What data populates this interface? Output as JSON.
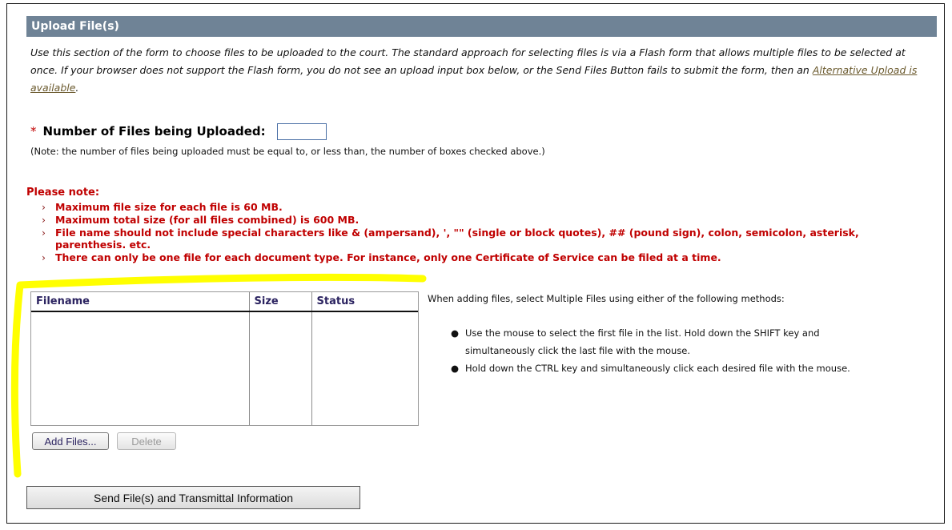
{
  "section": {
    "title": "Upload File(s)"
  },
  "intro": {
    "text_before_link": "Use this section of the form to choose files to be uploaded to the court. The standard approach for selecting files is via a Flash form that allows multiple files to be selected at once. If your browser does not support the Flash form, you do not see an upload input box below, or the Send Files Button fails to submit the form, then an ",
    "link_text": "Alternative Upload is available",
    "text_after_link": "."
  },
  "file_count": {
    "required_marker": "*",
    "label": "Number of Files being Uploaded:",
    "value": "",
    "note": "(Note: the number of files being uploaded must be equal to, or less than, the number of boxes checked above.)"
  },
  "notes": {
    "heading": "Please note:",
    "bullet_glyph": "›",
    "items": [
      "Maximum file size for each file is 60 MB.",
      "Maximum total size (for all files combined) is 600 MB.",
      "File name should not include special characters like & (ampersand), ', \"\" (single or block quotes), ## (pound sign), colon, semicolon, asterisk, parenthesis. etc.",
      "There can only be one file for each document type. For instance, only one Certificate of Service can be filed at a time."
    ],
    "color": "#c00000"
  },
  "file_table": {
    "columns": [
      "Filename",
      "Size",
      "Status"
    ],
    "rows": []
  },
  "buttons": {
    "add_files": "Add Files...",
    "delete": "Delete",
    "send": "Send File(s) and Transmittal Information"
  },
  "instructions": {
    "title": "When adding files, select Multiple Files using either of the following methods:",
    "bullet_glyph": "●",
    "items": [
      "Use the mouse to select the first file in the list. Hold down the SHIFT key and simultaneously click the last file with the mouse.",
      "Hold down the CTRL key and simultaneously click each desired file with the mouse."
    ]
  },
  "colors": {
    "header_bg": "#6f8396",
    "highlight": "#ffff00"
  }
}
